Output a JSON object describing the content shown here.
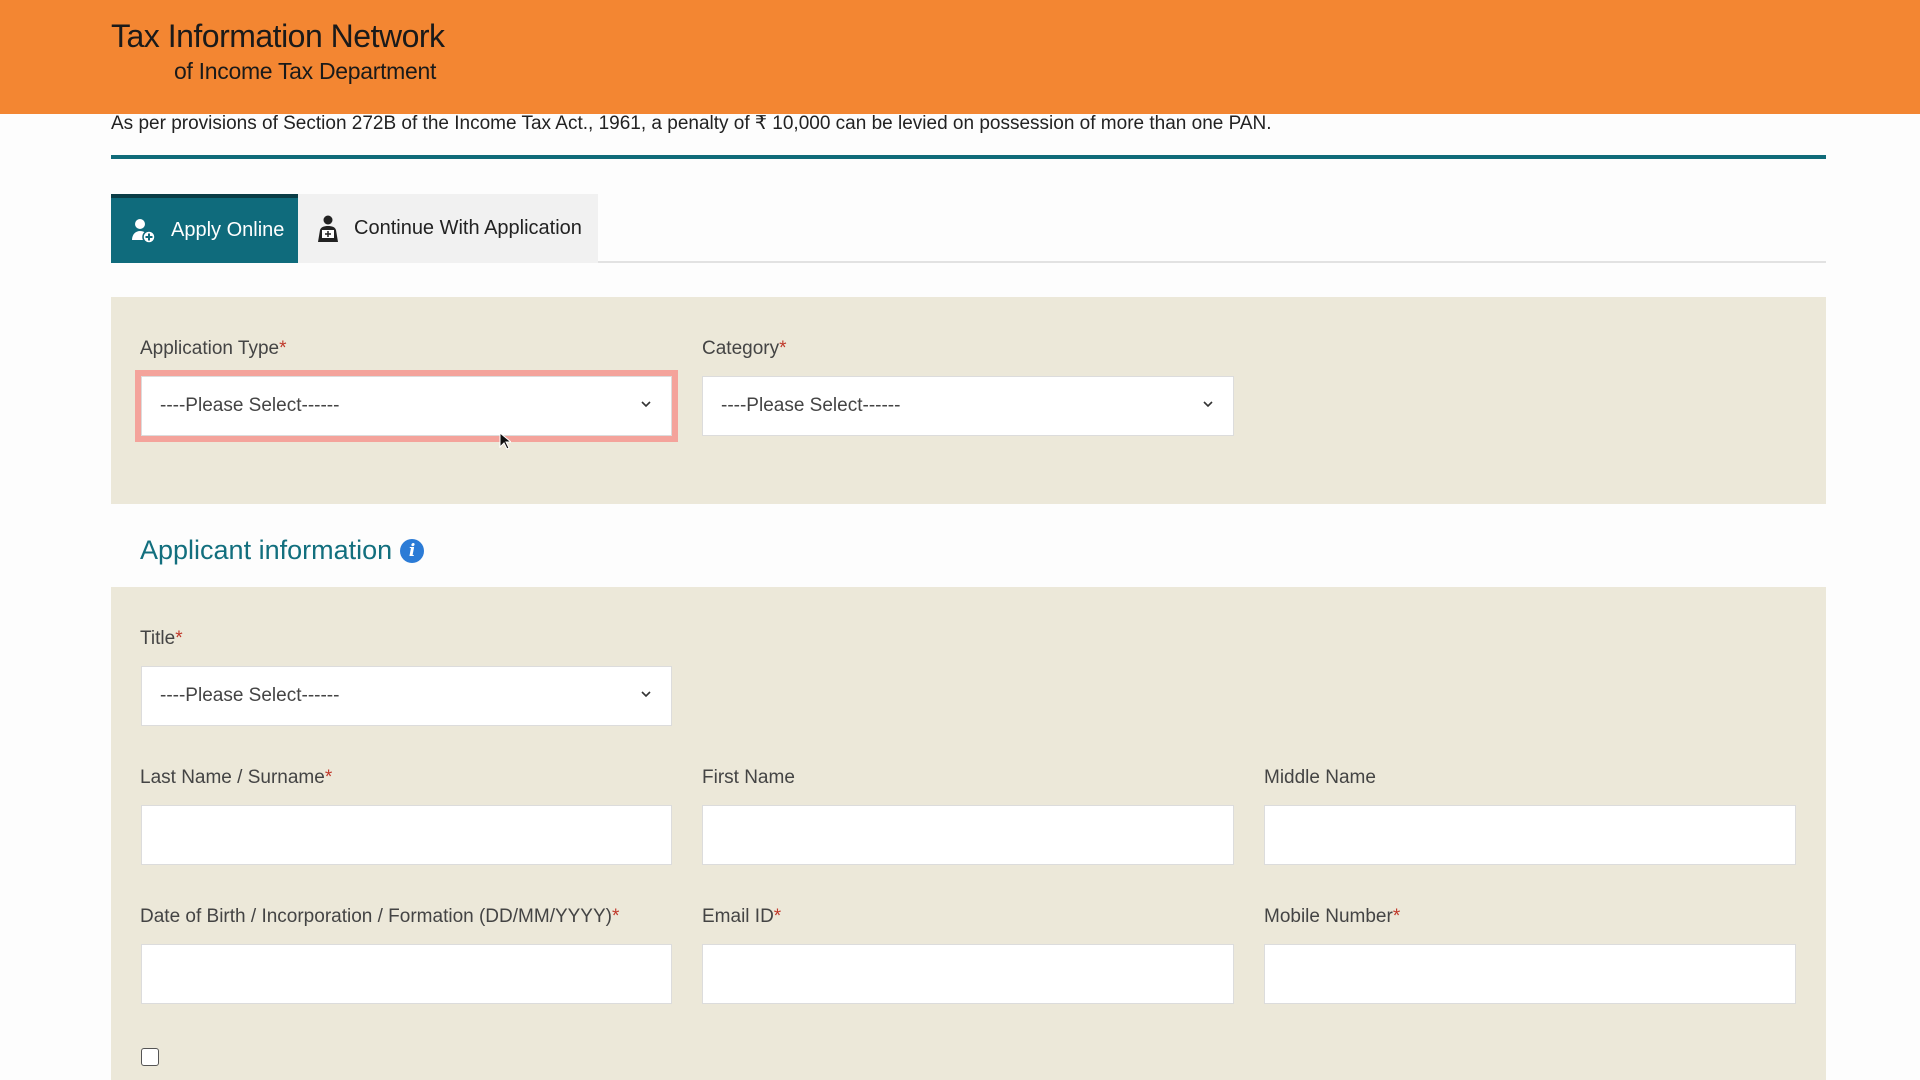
{
  "header": {
    "title": "Tax Information Network",
    "subtitle": "of Income Tax Department",
    "bg_color": "#f38632"
  },
  "notice": "As per provisions of Section 272B of the Income Tax Act., 1961, a penalty of ₹ 10,000 can be levied on possession of more than one PAN.",
  "tabs": [
    {
      "label": "Apply Online",
      "icon": "user-plus-icon",
      "active": true
    },
    {
      "label": "Continue With Application",
      "icon": "user-form-icon",
      "active": false
    }
  ],
  "application": {
    "type_label": "Application Type",
    "type_value": "----Please Select------",
    "category_label": "Category",
    "category_value": "----Please Select------"
  },
  "applicant": {
    "heading": "Applicant information",
    "info_icon": "i",
    "title_label": "Title",
    "title_value": "----Please Select------",
    "last_name_label": "Last Name / Surname",
    "first_name_label": "First Name",
    "middle_name_label": "Middle Name",
    "dob_label": "Date of Birth / Incorporation / Formation (DD/MM/YYYY)",
    "email_label": "Email ID",
    "mobile_label": "Mobile Number"
  },
  "required_mark": "*",
  "colors": {
    "accent": "#0f6b7c",
    "panel": "#ece8d9",
    "focus": "#f4a39b"
  }
}
